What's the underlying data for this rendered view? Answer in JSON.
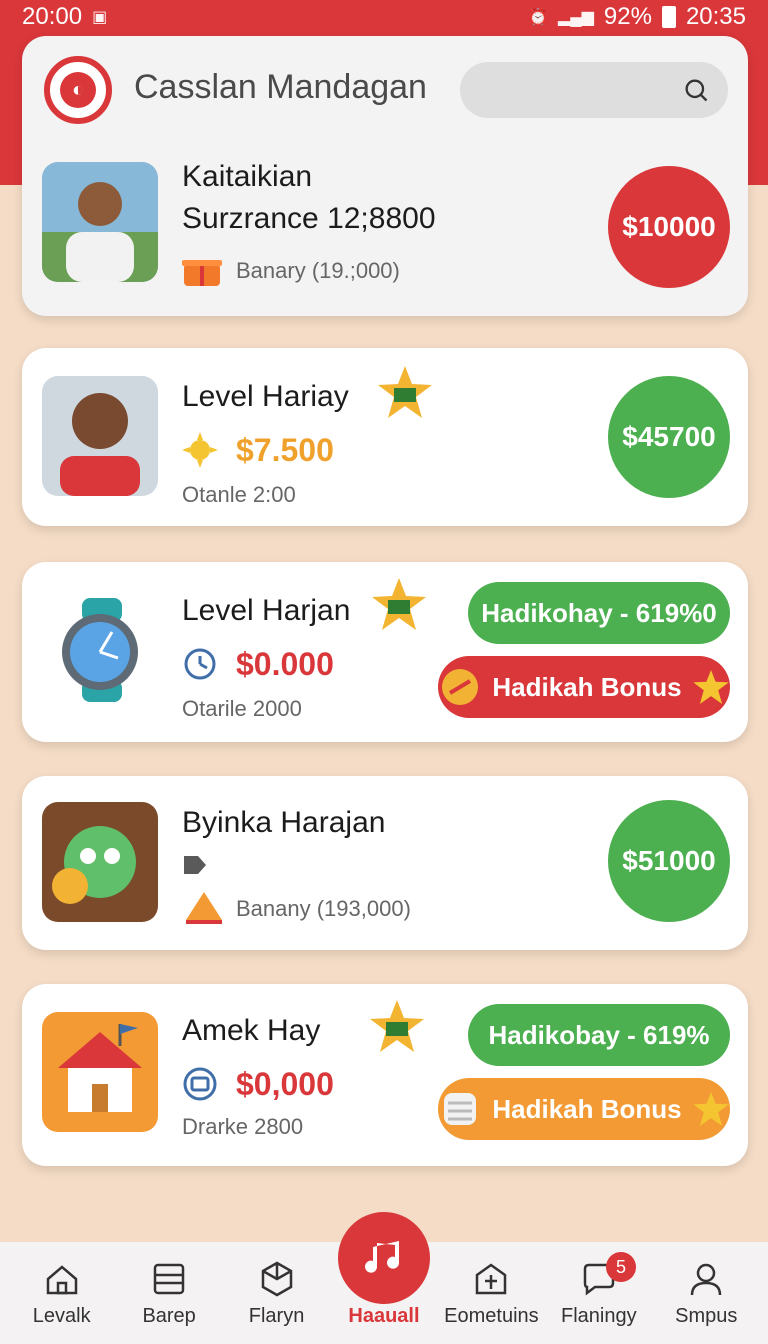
{
  "status": {
    "left_time": "20:00",
    "battery": "92%",
    "right_time": "20:35"
  },
  "app": {
    "title": "Casslan Mandagan"
  },
  "header_item": {
    "name": "Kaitaikian",
    "surrance": "Surzrance 12;8800",
    "sub": "Banary (19.;000)",
    "button": "$10000"
  },
  "cards": [
    {
      "name": "Level Hariay",
      "price": "$7.500",
      "sub": "Otanle 2:00",
      "button": "$45700"
    },
    {
      "name": "Level Harjan",
      "price": "$0.000",
      "sub": "Otarile 2000",
      "pill1": "Hadikohay - 619%0",
      "pill2": "Hadikah Bonus"
    },
    {
      "name": "Byinka Harajan",
      "sub": "Banany (193,000)",
      "button": "$51000"
    },
    {
      "name": "Amek Hay",
      "price": "$0,000",
      "sub": "Drarke 2800",
      "pill1": "Hadikobay - 619%",
      "pill2": "Hadikah Bonus"
    }
  ],
  "nav": [
    {
      "label": "Levalk",
      "icon": "home-icon"
    },
    {
      "label": "Barep",
      "icon": "list-icon"
    },
    {
      "label": "Flaryn",
      "icon": "cube-icon"
    },
    {
      "label": "Haauall",
      "icon": "music-icon"
    },
    {
      "label": "Eometuins",
      "icon": "building-icon"
    },
    {
      "label": "Flaningy",
      "icon": "chat-icon",
      "badge": "5"
    },
    {
      "label": "Smpus",
      "icon": "person-icon"
    }
  ],
  "colors": {
    "brand_red": "#d9373a",
    "green": "#4caf50",
    "orange": "#f39a34"
  }
}
